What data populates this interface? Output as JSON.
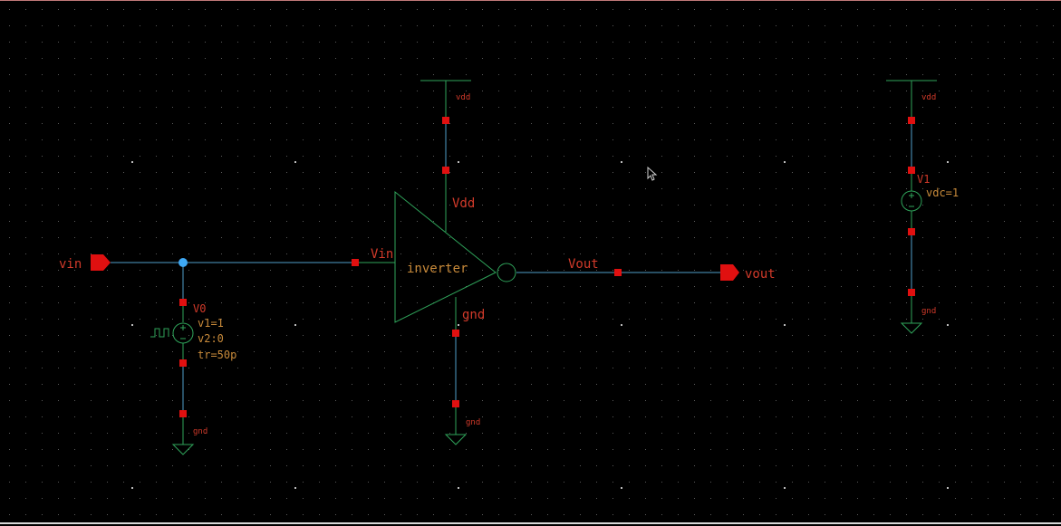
{
  "pins": {
    "vin": "vin",
    "vout": "vout"
  },
  "inverter": {
    "name": "inverter",
    "port_vin": "Vin",
    "port_vdd": "Vdd",
    "port_gnd": "gnd",
    "port_vout": "Vout"
  },
  "pulse_source": {
    "instance": "V0",
    "v1": "v1=1",
    "v2": "v2:0",
    "tr": "tr=50p"
  },
  "dc_source": {
    "instance": "V1",
    "vdc": "vdc=1"
  },
  "nets": {
    "vdd_inverter": "vdd",
    "vdd_source": "vdd",
    "gnd_pulse": "gnd",
    "gnd_inverter": "gnd",
    "gnd_source": "gnd"
  },
  "colors": {
    "background": "#000000",
    "wire": "#4f9ec8",
    "symbol": "#2fa35a",
    "label": "#d23a2a",
    "param": "#c88a3a",
    "pin": "#e01010",
    "junction": "#3fa9f5"
  }
}
